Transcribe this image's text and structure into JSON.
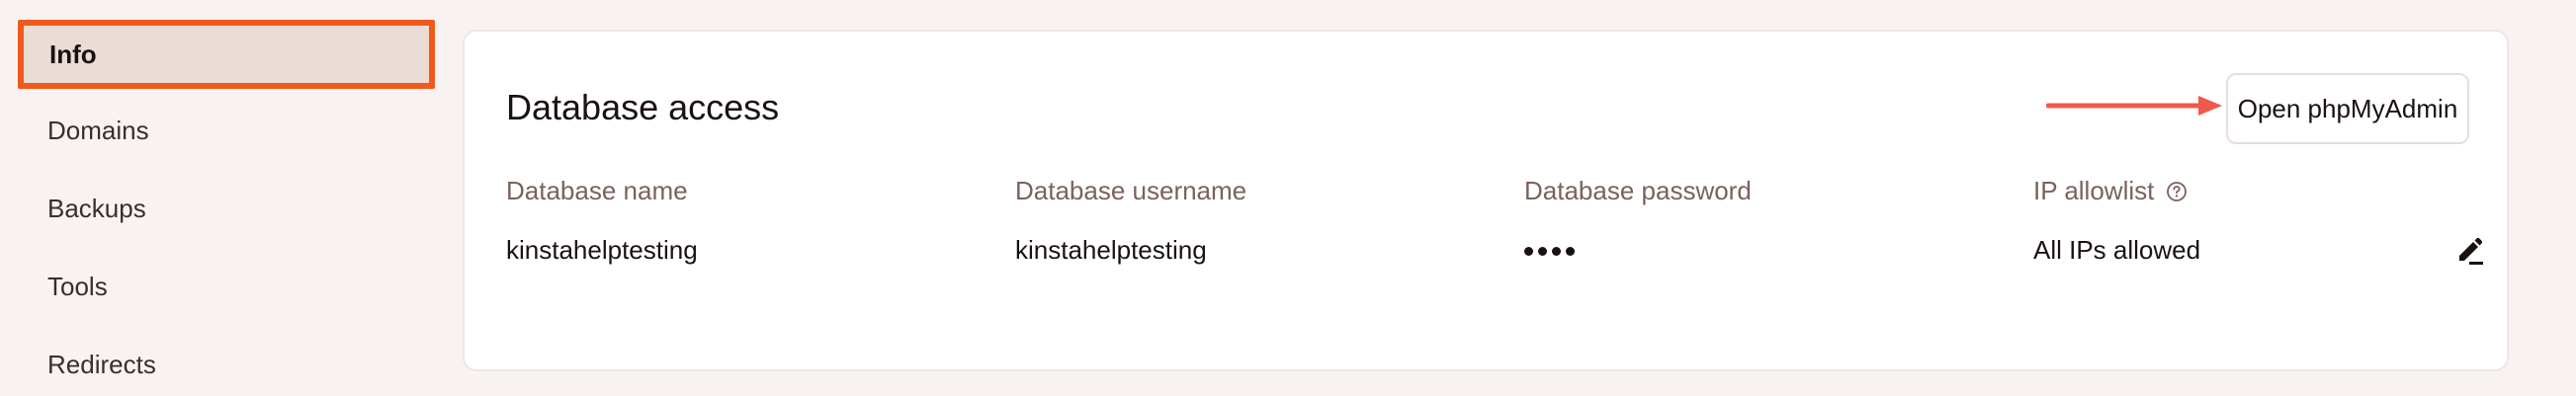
{
  "sidebar": {
    "items": [
      {
        "label": "Info",
        "active": true
      },
      {
        "label": "Domains"
      },
      {
        "label": "Backups"
      },
      {
        "label": "Tools"
      },
      {
        "label": "Redirects"
      }
    ]
  },
  "card": {
    "title": "Database access",
    "open_button_label": "Open phpMyAdmin",
    "columns": [
      {
        "header": "Database name",
        "value": "kinstahelptesting"
      },
      {
        "header": "Database username",
        "value": "kinstahelptesting"
      },
      {
        "header": "Database password",
        "value": "••••"
      },
      {
        "header": "IP allowlist",
        "value": "All IPs allowed"
      }
    ]
  },
  "icons": {
    "help": "question-circle-icon",
    "edit": "pencil-edit-icon",
    "annotation": "arrow-right-annotation"
  },
  "colors": {
    "highlight_border": "#f05a1a",
    "annotation_arrow": "#f0584a",
    "active_bg": "#ebdcd5",
    "header_text": "#7a625b",
    "page_bg": "#f8f3f2"
  }
}
